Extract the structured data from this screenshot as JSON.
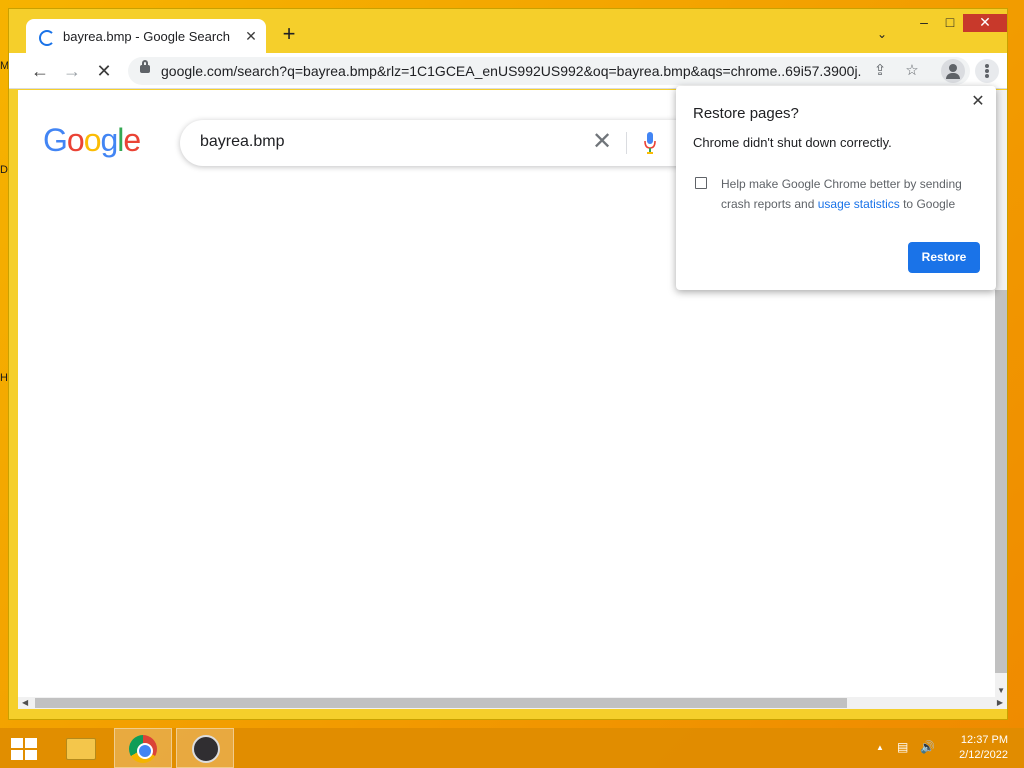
{
  "desktop": {
    "edge_glyphs": [
      "M",
      "D",
      "H"
    ]
  },
  "window": {
    "tab": {
      "title": "bayrea.bmp - Google Search",
      "close": "✕"
    },
    "new_tab": "+",
    "tab_search": "⌄",
    "controls": {
      "minimize": "–",
      "maximize": "□",
      "close": "✕"
    }
  },
  "toolbar": {
    "back": "←",
    "forward": "→",
    "stop": "✕",
    "url": "google.com/search?q=bayrea.bmp&rlz=1C1GCEA_enUS992US992&oq=bayrea.bmp&aqs=chrome..69i57.3900j...",
    "share_icon": "⇪",
    "star_icon": "☆"
  },
  "page": {
    "logo": [
      "G",
      "o",
      "o",
      "g",
      "l",
      "e"
    ],
    "logo_colors": [
      "#4285F4",
      "#EA4335",
      "#FBBC05",
      "#4285F4",
      "#34A853",
      "#EA4335"
    ],
    "search_value": "bayrea.bmp",
    "clear": "✕"
  },
  "popup": {
    "title": "Restore pages?",
    "subtitle": "Chrome didn't shut down correctly.",
    "checkbox_text_before": "Help make Google Chrome better by sending crash reports and ",
    "checkbox_link": "usage statistics",
    "checkbox_text_after": " to Google",
    "restore_label": "Restore",
    "close": "✕"
  },
  "taskbar": {
    "time": "12:37 PM",
    "date": "2/12/2022",
    "tray_up": "▲"
  },
  "colors": {
    "accent": "#1a73e8",
    "titlebar": "#f5cf2b",
    "taskbar": "#e08c00"
  }
}
